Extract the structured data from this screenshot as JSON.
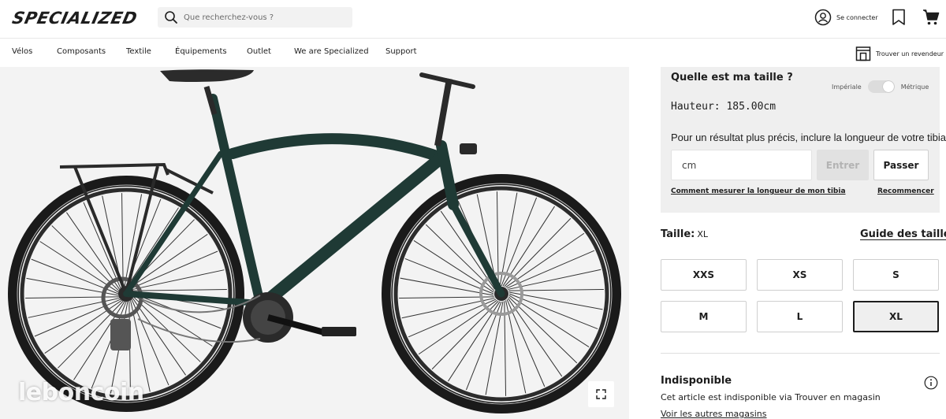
{
  "header": {
    "logo_text": "SPECIALIZED",
    "search": {
      "placeholder": "Que recherchez-vous ?",
      "icon": "search-icon"
    },
    "account": {
      "label": "Se connecter",
      "icon": "user-circle-icon"
    },
    "bookmark_icon": "bookmark-icon",
    "cart_icon": "cart-icon"
  },
  "nav": {
    "items": [
      "Vélos",
      "Composants",
      "Textile",
      "Équipements",
      "Outlet",
      "We are Specialized",
      "Support"
    ],
    "dealer": {
      "label": "Trouver un revendeur",
      "icon": "store-icon"
    }
  },
  "gallery": {
    "watermark": "leboncoin",
    "expand_icon": "expand-icon"
  },
  "size_finder": {
    "title": "Quelle est ma taille ?",
    "unit_imperial": "Impériale",
    "unit_metric": "Métrique",
    "height_label": "Hauteur:",
    "height_value": "185.00cm",
    "precision_text": "Pour un résultat plus précis, inclure la longueur de votre tibia.",
    "input_placeholder": "cm",
    "enter_label": "Entrer",
    "skip_label": "Passer",
    "measure_link": "Comment mesurer la longueur de mon tibia",
    "restart_link": "Recommencer"
  },
  "size_select": {
    "label": "Taille:",
    "selected": "XL",
    "guide_link": "Guide des tailles",
    "sizes": [
      "XXS",
      "XS",
      "S",
      "M",
      "L",
      "XL"
    ]
  },
  "availability": {
    "status": "Indisponible",
    "description": "Cet article est indisponible via Trouver en magasin",
    "link": "Voir les autres magasins",
    "icon": "info-icon"
  },
  "colors": {
    "text": "#1d1d1d",
    "frame": "#1f3a35",
    "panel_bg": "#efefef"
  }
}
